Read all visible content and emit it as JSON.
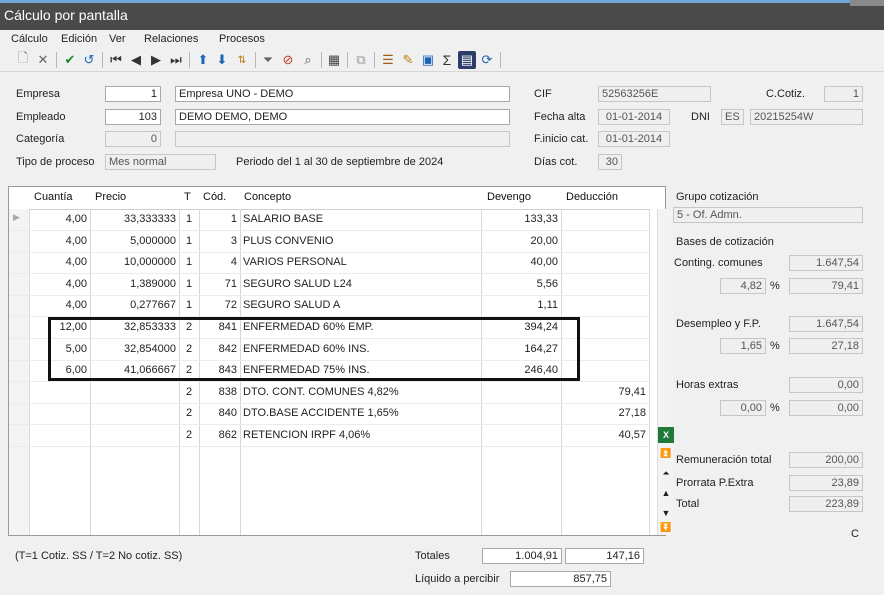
{
  "window": {
    "title": "Cálculo por pantalla"
  },
  "menu": [
    {
      "label": "Cálculo"
    },
    {
      "label": "Edición"
    },
    {
      "label": "Ver"
    },
    {
      "label": "Relaciones"
    },
    {
      "label": "Procesos"
    }
  ],
  "toolbar": {
    "icons": [
      "new-icon",
      "delete-icon",
      "accept-icon",
      "undo-icon",
      "first-icon",
      "prev-icon",
      "next-icon",
      "last-icon",
      "move-up-icon",
      "move-down-icon",
      "sort-icon",
      "filter-icon",
      "clear-filter-icon",
      "search-icon",
      "grid-icon",
      "copy-icon",
      "list-icon",
      "edit-icon",
      "export-icon",
      "sum-icon",
      "form-icon",
      "refresh-icon"
    ]
  },
  "form": {
    "empresa": {
      "label": "Empresa",
      "code": "1",
      "name": "Empresa UNO - DEMO"
    },
    "empleado": {
      "label": "Empleado",
      "code": "103",
      "name": "DEMO DEMO, DEMO"
    },
    "categoria": {
      "label": "Categoría",
      "code": "0",
      "name": ""
    },
    "tipo": {
      "label": "Tipo de proceso",
      "value": "Mes normal",
      "periodo": "Periodo del 1 al 30 de septiembre de 2024"
    },
    "cif": {
      "label": "CIF",
      "value": "52563256E"
    },
    "ccotiz": {
      "label": "C.Cotiz.",
      "value": "1"
    },
    "fecha_alta": {
      "label": "Fecha alta",
      "value": "01-01-2014"
    },
    "dni": {
      "label": "DNI",
      "country": "ES",
      "value": "20215254W"
    },
    "finicio": {
      "label": "F.inicio cat.",
      "value": "01-01-2014"
    },
    "dias": {
      "label": "Días cot.",
      "value": "30"
    }
  },
  "grid": {
    "headers": {
      "cuantia": "Cuantía",
      "precio": "Precio",
      "t": "T",
      "cod": "Cód.",
      "concepto": "Concepto",
      "devengo": "Devengo",
      "deduccion": "Deducción"
    },
    "rows": [
      {
        "cuantia": "4,00",
        "precio": "33,333333",
        "t": "1",
        "cod": "1",
        "concepto": "SALARIO BASE",
        "devengo": "133,33",
        "deduccion": ""
      },
      {
        "cuantia": "4,00",
        "precio": "5,000000",
        "t": "1",
        "cod": "3",
        "concepto": "PLUS CONVENIO",
        "devengo": "20,00",
        "deduccion": ""
      },
      {
        "cuantia": "4,00",
        "precio": "10,000000",
        "t": "1",
        "cod": "4",
        "concepto": "VARIOS PERSONAL",
        "devengo": "40,00",
        "deduccion": ""
      },
      {
        "cuantia": "4,00",
        "precio": "1,389000",
        "t": "1",
        "cod": "71",
        "concepto": "SEGURO SALUD L24",
        "devengo": "5,56",
        "deduccion": ""
      },
      {
        "cuantia": "4,00",
        "precio": "0,277667",
        "t": "1",
        "cod": "72",
        "concepto": "SEGURO SALUD A",
        "devengo": "1,11",
        "deduccion": ""
      },
      {
        "cuantia": "12,00",
        "precio": "32,853333",
        "t": "2",
        "cod": "841",
        "concepto": "ENFERMEDAD 60% EMP.",
        "devengo": "394,24",
        "deduccion": ""
      },
      {
        "cuantia": "5,00",
        "precio": "32,854000",
        "t": "2",
        "cod": "842",
        "concepto": "ENFERMEDAD 60% INS.",
        "devengo": "164,27",
        "deduccion": ""
      },
      {
        "cuantia": "6,00",
        "precio": "41,066667",
        "t": "2",
        "cod": "843",
        "concepto": "ENFERMEDAD 75% INS.",
        "devengo": "246,40",
        "deduccion": ""
      },
      {
        "cuantia": "",
        "precio": "",
        "t": "2",
        "cod": "838",
        "concepto": "DTO. CONT. COMUNES 4,82%",
        "devengo": "",
        "deduccion": "79,41"
      },
      {
        "cuantia": "",
        "precio": "",
        "t": "2",
        "cod": "840",
        "concepto": "DTO.BASE ACCIDENTE 1,65%",
        "devengo": "",
        "deduccion": "27,18"
      },
      {
        "cuantia": "",
        "precio": "",
        "t": "2",
        "cod": "862",
        "concepto": "RETENCION IRPF    4,06%",
        "devengo": "",
        "deduccion": "40,57"
      }
    ]
  },
  "right": {
    "grupo_label": "Grupo cotización",
    "grupo_value": "5 - Of. Admn.",
    "bases_label": "Bases de cotización",
    "conting_label": "Conting. comunes",
    "conting_base": "1.647,54",
    "conting_pct": "4,82",
    "conting_amount": "79,41",
    "desempleo_label": "Desempleo y F.P.",
    "desempleo_base": "1.647,54",
    "desempleo_pct": "1,65",
    "desempleo_amount": "27,18",
    "horas_label": "Horas extras",
    "horas_base": "0,00",
    "horas_pct": "0,00",
    "horas_amount": "0,00",
    "pct_symbol": "%",
    "rem_label": "Remuneración total",
    "rem_value": "200,00",
    "prorrata_label": "Prorrata P.Extra",
    "prorrata_value": "23,89",
    "total_label": "Total",
    "total_value": "223,89",
    "c_label": "C"
  },
  "footer": {
    "legend": "(T=1 Cotiz. SS / T=2 No cotiz. SS)",
    "totales_label": "Totales",
    "total_devengo": "1.004,91",
    "total_deduccion": "147,16",
    "liquido_label": "Líquido a percibir",
    "liquido_value": "857,75"
  }
}
